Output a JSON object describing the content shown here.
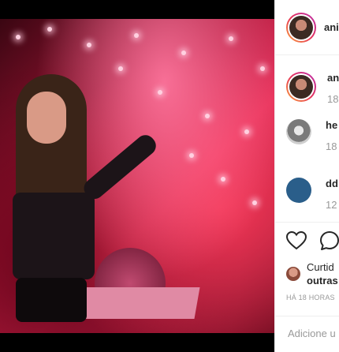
{
  "post": {
    "username": "ani",
    "photo_alt": ""
  },
  "comments": [
    {
      "user": "an",
      "time": "18",
      "avatar_color": "#3b2a22"
    },
    {
      "user": "he",
      "time": "18",
      "avatar_color": "#9a9a9a"
    },
    {
      "user": "dd",
      "time": "12",
      "avatar_color": "#2a5e8a"
    }
  ],
  "actions": {
    "likes_line1": "Curtid",
    "likes_line2": "outras",
    "time_ago": "HÁ 18 HORAS"
  },
  "comment_input": {
    "placeholder": "Adicione u"
  }
}
